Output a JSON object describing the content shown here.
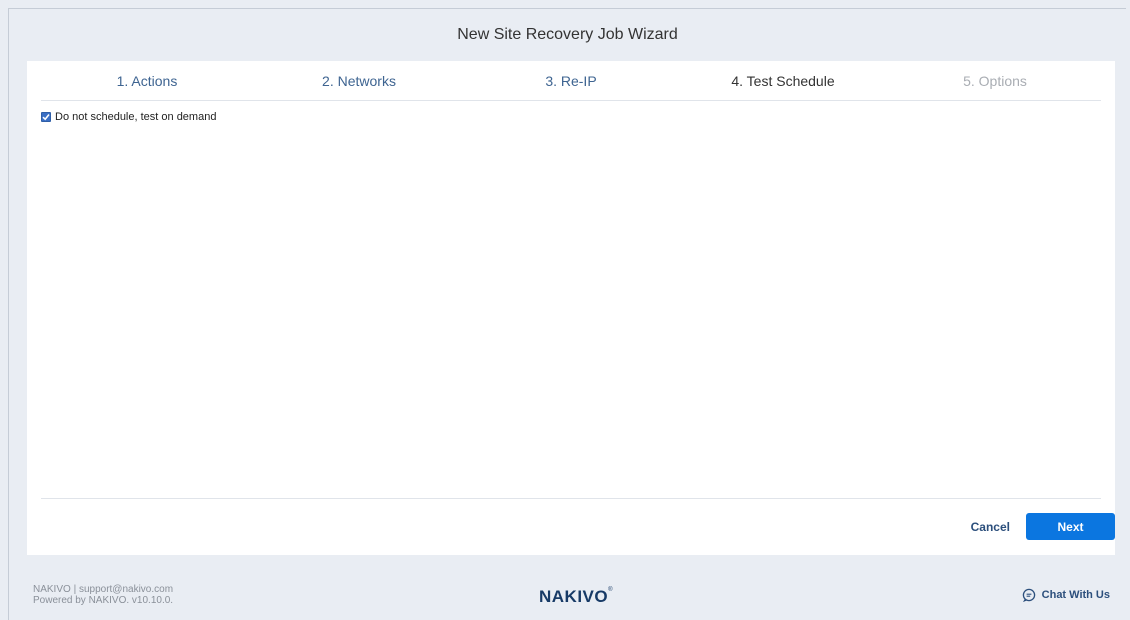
{
  "window": {
    "title": "New Site Recovery Job Wizard"
  },
  "steps": [
    {
      "label": "1. Actions",
      "state": "done"
    },
    {
      "label": "2. Networks",
      "state": "done"
    },
    {
      "label": "3. Re-IP",
      "state": "done"
    },
    {
      "label": "4. Test Schedule",
      "state": "active"
    },
    {
      "label": "5. Options",
      "state": "future"
    }
  ],
  "schedule": {
    "no_schedule_label": "Do not schedule, test on demand",
    "no_schedule_checked": true
  },
  "buttons": {
    "cancel": "Cancel",
    "next": "Next"
  },
  "footer": {
    "company_email": "NAKIVO | support@nakivo.com",
    "powered_by": "Powered by NAKIVO. v10.10.0.",
    "logo_text": "NAKIVO",
    "logo_mark": "®",
    "chat": "Chat With Us",
    "chat_icon": "chat-bubble-icon"
  },
  "colors": {
    "accent": "#0b76e0",
    "link": "#3e6491",
    "background": "#e9edf3"
  }
}
